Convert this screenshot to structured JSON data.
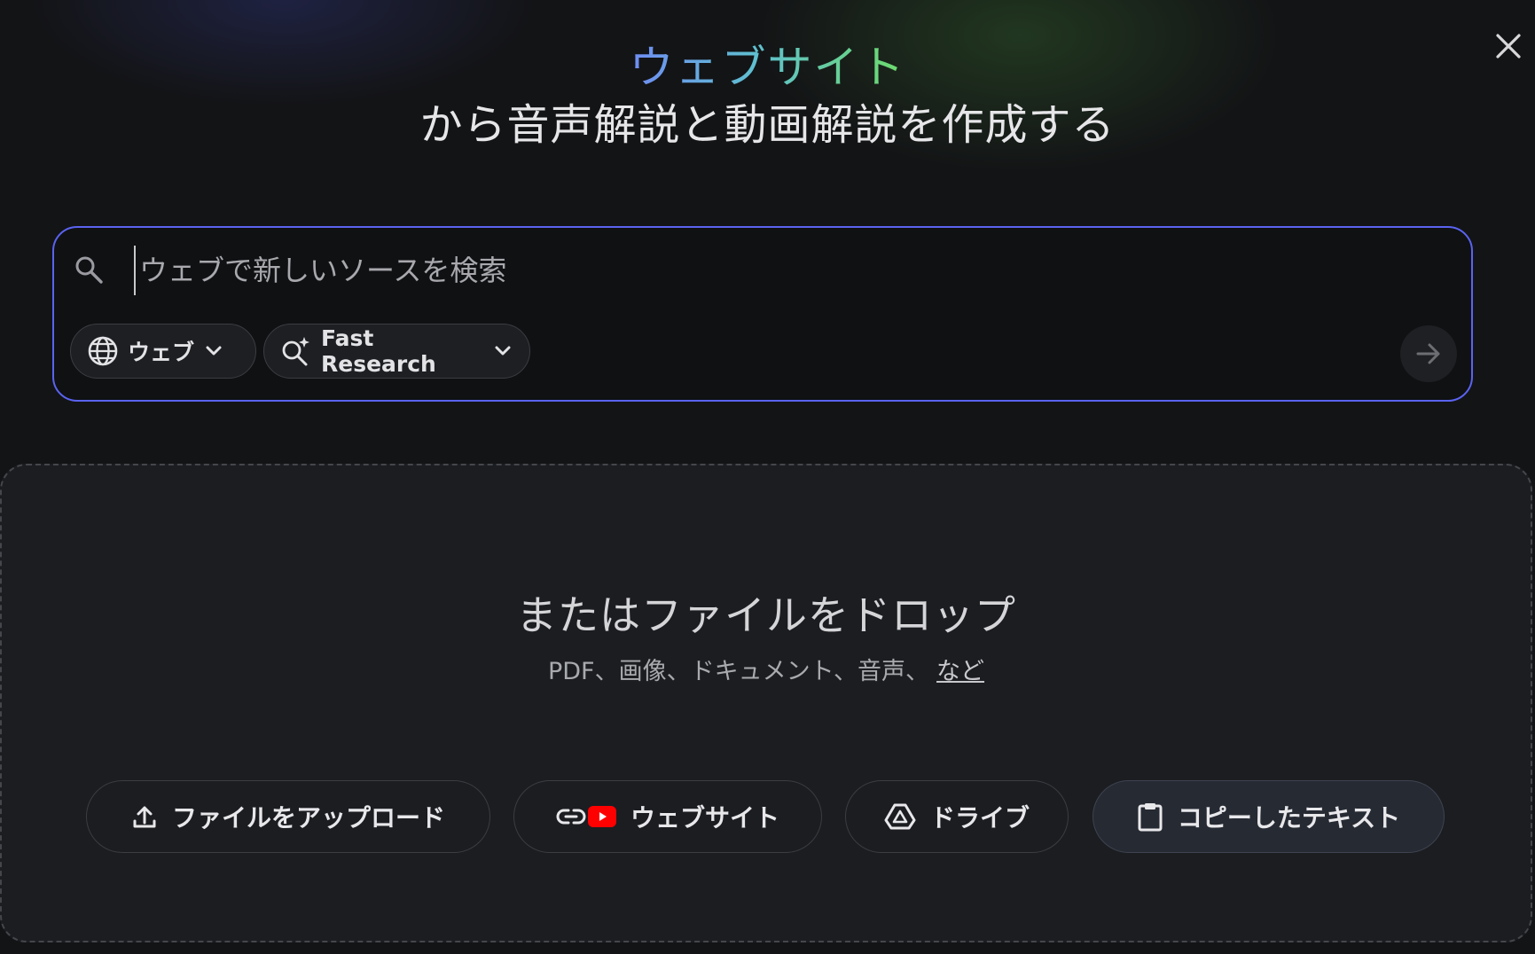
{
  "dialog": {
    "close_label": "×"
  },
  "headline": {
    "accent": "ウェブサイト",
    "main": "から音声解説と動画解説を作成する"
  },
  "search": {
    "placeholder": "ウェブで新しいソースを検索",
    "value": "",
    "source_chip_label": "ウェブ",
    "mode_chip_label": "Fast Research"
  },
  "drop_zone": {
    "title": "またはファイルをドロップ",
    "subtitle": "PDF、画像、ドキュメント、音声、",
    "more_link": "など"
  },
  "actions": {
    "upload_label": "ファイルをアップロード",
    "website_label": "ウェブサイト",
    "drive_label": "ドライブ",
    "copied_text_label": "コピーしたテキスト"
  },
  "colors": {
    "accent_border": "#5a63f0",
    "youtube_red": "#ff0000"
  },
  "icons": {
    "close": "close-icon",
    "search": "search-icon",
    "globe": "globe-icon",
    "research": "sparkle-search-icon",
    "submit": "arrow-right-icon",
    "upload": "upload-icon",
    "link": "link-icon",
    "youtube": "youtube-icon",
    "drive": "drive-icon",
    "clipboard": "clipboard-icon"
  }
}
